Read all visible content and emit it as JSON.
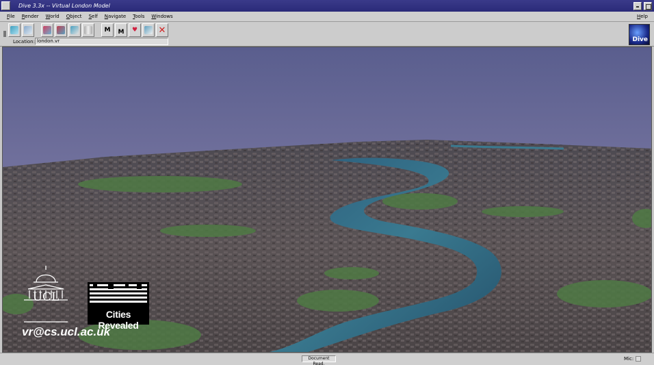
{
  "window": {
    "title": "Dive 3.3x -- Virtual London Model"
  },
  "menu": {
    "items": [
      "File",
      "Render",
      "World",
      "Object",
      "Self",
      "Navigate",
      "Tools",
      "Windows"
    ],
    "help": "Help"
  },
  "toolbar": {
    "buttons": [
      {
        "name": "new-world-icon",
        "color": "#3fa0c0"
      },
      {
        "name": "network-icon",
        "color": "#88aacc"
      },
      {
        "name": "object-add-icon",
        "color": "#d04060"
      },
      {
        "name": "object-edit-icon",
        "color": "#c04050"
      },
      {
        "name": "shape-icon",
        "color": "#4aa0c0"
      },
      {
        "name": "pillar-icon",
        "color": "#c8c8c8"
      },
      {
        "name": "mark-m-icon",
        "label": "M"
      },
      {
        "name": "mark-m2-icon",
        "label": "M"
      },
      {
        "name": "heart-icon",
        "color": "#d02040"
      },
      {
        "name": "wave-icon",
        "color": "#60a0c0"
      },
      {
        "name": "stop-cross-icon",
        "color": "#d02020"
      }
    ],
    "location_label": "Location:",
    "location_value": "london.vr",
    "logo_text": "Dive"
  },
  "viewport": {
    "overlay": {
      "ucl": "UCL",
      "cities": "Cities Revealed",
      "email": "vr@cs.ucl.ac.uk"
    }
  },
  "status": {
    "text": "Document Read.",
    "mic_label": "Mic:"
  }
}
